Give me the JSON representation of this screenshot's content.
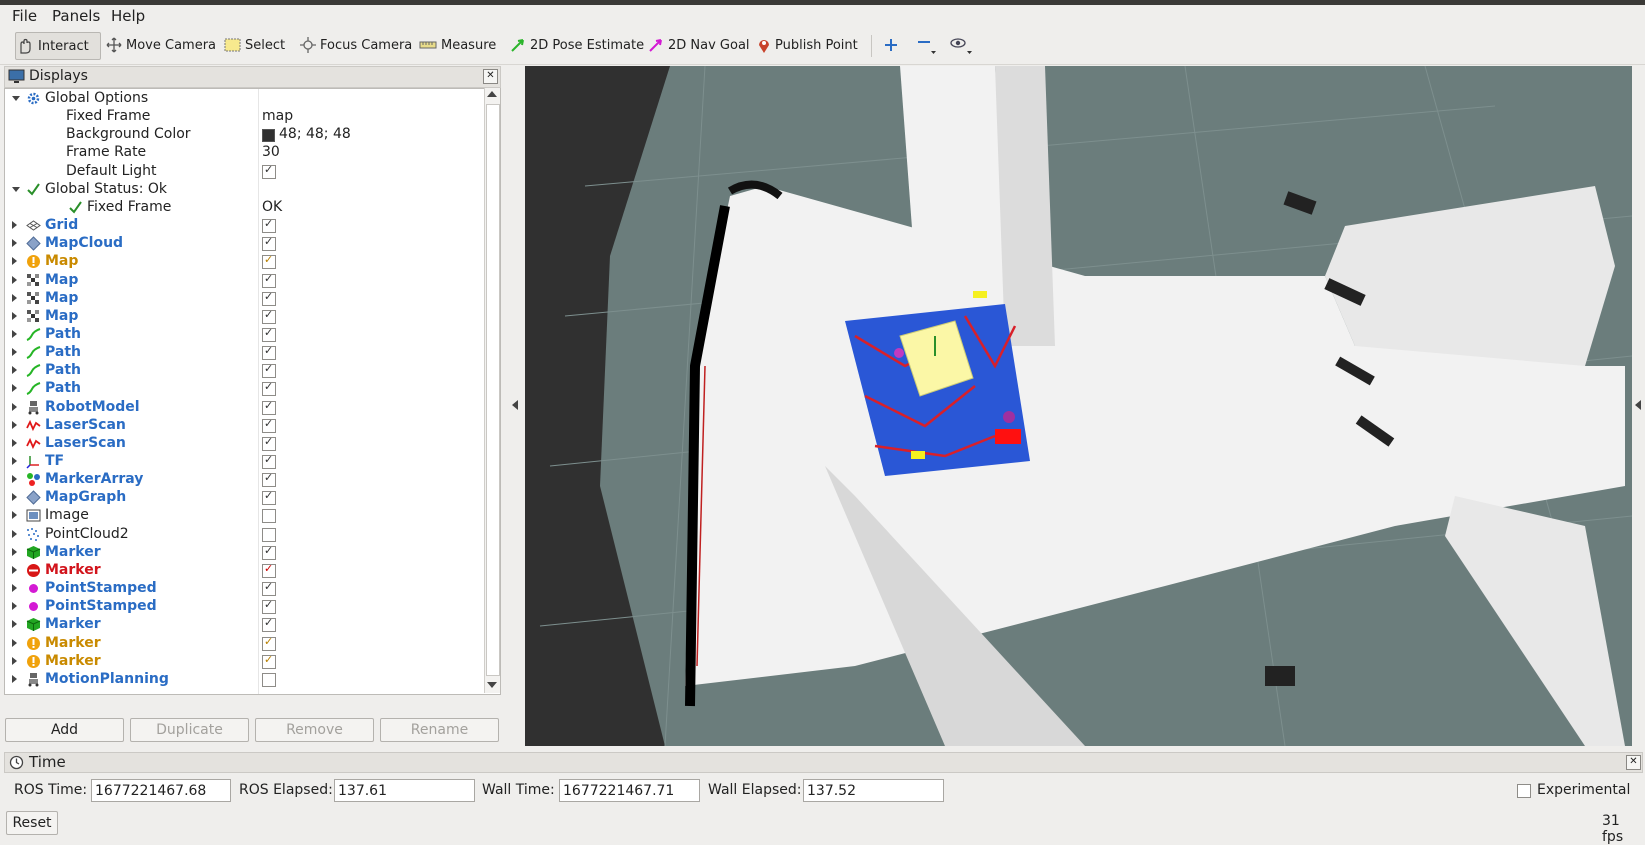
{
  "menu": [
    "File",
    "Panels",
    "Help"
  ],
  "toolbar": {
    "interact": "Interact",
    "move_camera": "Move Camera",
    "select": "Select",
    "focus_camera": "Focus Camera",
    "measure": "Measure",
    "pose_estimate": "2D Pose Estimate",
    "nav_goal": "2D Nav Goal",
    "publish_point": "Publish Point"
  },
  "displays": {
    "title": "Displays",
    "rows": [
      {
        "name": "Global Options",
        "value": "",
        "style": "normal",
        "icon": "gear-icon",
        "indent": 0,
        "expand": "down"
      },
      {
        "name": "Fixed Frame",
        "value": "map",
        "style": "normal",
        "icon": "",
        "indent": 1,
        "expand": ""
      },
      {
        "name": "Background Color",
        "value": "48; 48; 48",
        "style": "normal",
        "icon": "",
        "indent": 1,
        "expand": "",
        "swatch": "#303030"
      },
      {
        "name": "Frame Rate",
        "value": "30",
        "style": "normal",
        "icon": "",
        "indent": 1,
        "expand": ""
      },
      {
        "name": "Default Light",
        "value": "",
        "style": "normal",
        "icon": "",
        "indent": 1,
        "expand": "",
        "check": "checked"
      },
      {
        "name": "Global Status: Ok",
        "value": "",
        "style": "normal",
        "icon": "ok-icon",
        "indent": 0,
        "expand": "down"
      },
      {
        "name": "Fixed Frame",
        "value": "OK",
        "style": "normal",
        "icon": "ok-icon",
        "indent": 2,
        "expand": ""
      },
      {
        "name": "Grid",
        "value": "",
        "style": "blue",
        "icon": "grid-icon",
        "indent": 0,
        "expand": "right",
        "check": "checked"
      },
      {
        "name": "MapCloud",
        "value": "",
        "style": "blue",
        "icon": "diamond-icon",
        "indent": 0,
        "expand": "right",
        "check": "checked"
      },
      {
        "name": "Map",
        "value": "",
        "style": "orange",
        "icon": "warning-icon",
        "indent": 0,
        "expand": "right",
        "check": "checked-orange"
      },
      {
        "name": "Map",
        "value": "",
        "style": "blue",
        "icon": "map-icon",
        "indent": 0,
        "expand": "right",
        "check": "checked"
      },
      {
        "name": "Map",
        "value": "",
        "style": "blue",
        "icon": "map-icon",
        "indent": 0,
        "expand": "right",
        "check": "checked"
      },
      {
        "name": "Map",
        "value": "",
        "style": "blue",
        "icon": "map-icon",
        "indent": 0,
        "expand": "right",
        "check": "checked"
      },
      {
        "name": "Path",
        "value": "",
        "style": "blue",
        "icon": "path-icon",
        "indent": 0,
        "expand": "right",
        "check": "checked"
      },
      {
        "name": "Path",
        "value": "",
        "style": "blue",
        "icon": "path-icon",
        "indent": 0,
        "expand": "right",
        "check": "checked"
      },
      {
        "name": "Path",
        "value": "",
        "style": "blue",
        "icon": "path-icon",
        "indent": 0,
        "expand": "right",
        "check": "checked"
      },
      {
        "name": "Path",
        "value": "",
        "style": "blue",
        "icon": "path-icon",
        "indent": 0,
        "expand": "right",
        "check": "checked"
      },
      {
        "name": "RobotModel",
        "value": "",
        "style": "blue",
        "icon": "robot-icon",
        "indent": 0,
        "expand": "right",
        "check": "checked"
      },
      {
        "name": "LaserScan",
        "value": "",
        "style": "blue",
        "icon": "laser-icon",
        "indent": 0,
        "expand": "right",
        "check": "checked"
      },
      {
        "name": "LaserScan",
        "value": "",
        "style": "blue",
        "icon": "laser-icon",
        "indent": 0,
        "expand": "right",
        "check": "checked"
      },
      {
        "name": "TF",
        "value": "",
        "style": "blue",
        "icon": "axes-icon",
        "indent": 0,
        "expand": "right",
        "check": "checked"
      },
      {
        "name": "MarkerArray",
        "value": "",
        "style": "blue",
        "icon": "markerarray-icon",
        "indent": 0,
        "expand": "right",
        "check": "checked"
      },
      {
        "name": "MapGraph",
        "value": "",
        "style": "blue",
        "icon": "diamond-icon",
        "indent": 0,
        "expand": "right",
        "check": "checked"
      },
      {
        "name": "Image",
        "value": "",
        "style": "normal",
        "icon": "image-icon",
        "indent": 0,
        "expand": "right",
        "check": "unchecked"
      },
      {
        "name": "PointCloud2",
        "value": "",
        "style": "normal",
        "icon": "dots-icon",
        "indent": 0,
        "expand": "right",
        "check": "unchecked"
      },
      {
        "name": "Marker",
        "value": "",
        "style": "blue",
        "icon": "cube-icon",
        "indent": 0,
        "expand": "right",
        "check": "checked"
      },
      {
        "name": "Marker",
        "value": "",
        "style": "red",
        "icon": "error-icon",
        "indent": 0,
        "expand": "right",
        "check": "checked-red"
      },
      {
        "name": "PointStamped",
        "value": "",
        "style": "blue",
        "icon": "point-icon",
        "indent": 0,
        "expand": "right",
        "check": "checked"
      },
      {
        "name": "PointStamped",
        "value": "",
        "style": "blue",
        "icon": "point-icon",
        "indent": 0,
        "expand": "right",
        "check": "checked"
      },
      {
        "name": "Marker",
        "value": "",
        "style": "blue",
        "icon": "cube-icon",
        "indent": 0,
        "expand": "right",
        "check": "checked"
      },
      {
        "name": "Marker",
        "value": "",
        "style": "orange",
        "icon": "warning-icon",
        "indent": 0,
        "expand": "right",
        "check": "checked-orange"
      },
      {
        "name": "Marker",
        "value": "",
        "style": "orange",
        "icon": "warning-icon",
        "indent": 0,
        "expand": "right",
        "check": "checked-orange"
      },
      {
        "name": "MotionPlanning",
        "value": "",
        "style": "blue",
        "icon": "robot-icon",
        "indent": 0,
        "expand": "right",
        "check": "unchecked"
      }
    ],
    "buttons": {
      "add": "Add",
      "duplicate": "Duplicate",
      "remove": "Remove",
      "rename": "Rename"
    }
  },
  "time": {
    "title": "Time",
    "ros_time_label": "ROS Time:",
    "ros_time": "1677221467.68",
    "ros_elapsed_label": "ROS Elapsed:",
    "ros_elapsed": "137.61",
    "wall_time_label": "Wall Time:",
    "wall_time": "1677221467.71",
    "wall_elapsed_label": "Wall Elapsed:",
    "wall_elapsed": "137.52",
    "experimental_label": "Experimental",
    "reset": "Reset",
    "fps": "31 fps"
  },
  "colors": {
    "status_blue": "#2a6cc4",
    "status_orange": "#c98a00",
    "status_red": "#d2141c",
    "background": "#303030"
  }
}
